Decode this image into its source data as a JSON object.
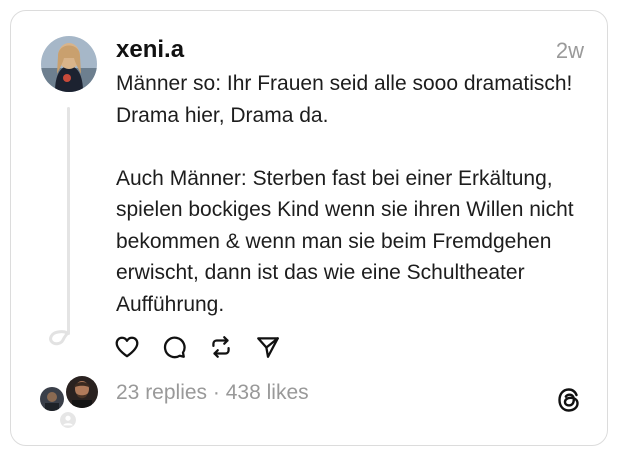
{
  "post": {
    "username": "xeni.a",
    "timestamp": "2w",
    "paragraphs": [
      "Männer so: Ihr Frauen seid alle sooo dramatisch! Drama hier, Drama da.",
      "Auch Männer: Sterben fast bei einer Erkältung, spielen bockiges Kind wenn sie ihren Willen nicht bekommen & wenn man sie beim Fremdgehen erwischt, dann ist das wie eine Schultheater Aufführung."
    ],
    "stats": {
      "replies": "23 replies",
      "separator": "·",
      "likes": "438 likes"
    }
  },
  "icons": {
    "like": "heart-icon",
    "reply": "comment-bubble-icon",
    "repost": "repost-icon",
    "share": "send-icon",
    "brand": "threads-logo-icon"
  },
  "colors": {
    "text": "#1d1d1d",
    "muted": "#999999",
    "border": "#dcdcdc",
    "thread_line": "#e4e4e4"
  }
}
